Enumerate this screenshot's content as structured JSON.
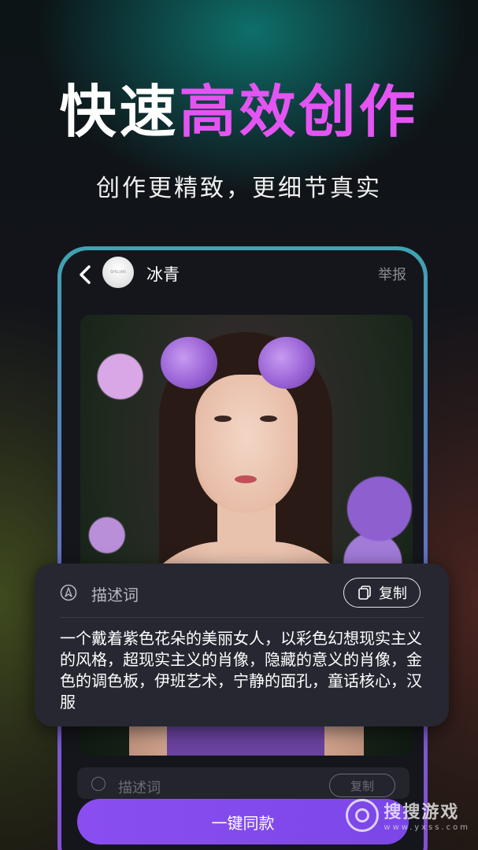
{
  "headline": {
    "part1": "快速",
    "part2": "高效创作"
  },
  "subtitle": "创作更精致，更细节真实",
  "post": {
    "username": "冰青",
    "avatar_text": "SHILIAN",
    "report_label": "举报"
  },
  "prompt_card": {
    "label": "描述词",
    "copy_label": "复制",
    "text": "一个戴着紫色花朵的美丽女人，以彩色幻想现实主义的风格，超现实主义的肖像，隐藏的意义的肖像，金色的调色板，伊班艺术，宁静的面孔，童话核心，汉服"
  },
  "ghost_row": {
    "label": "描述词",
    "copy_label": "复制"
  },
  "cta_label": "一键同款",
  "watermark": {
    "brand": "搜搜游戏",
    "url": "www.yxss.com"
  },
  "colors": {
    "accent": "#e454f2",
    "button": "#8a4ef0"
  }
}
